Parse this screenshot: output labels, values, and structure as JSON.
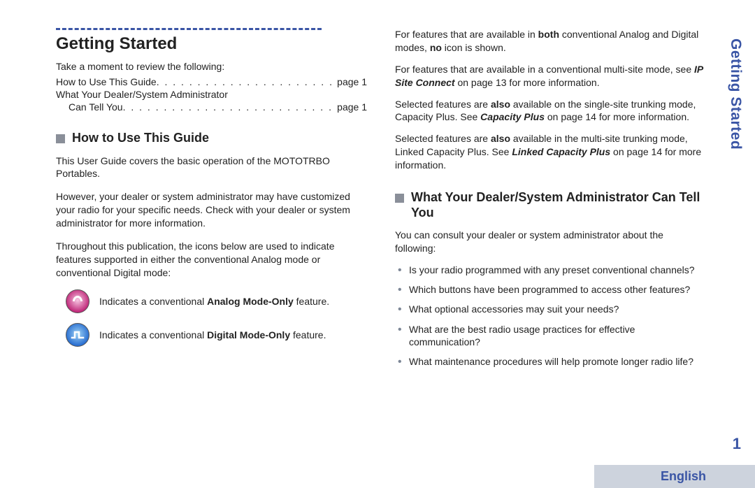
{
  "sideTab": "Getting Started",
  "pageNumber": "1",
  "langFooter": "English",
  "left": {
    "title": "Getting Started",
    "intro": "Take a moment to review the following:",
    "toc": {
      "row1Label": "How to Use This Guide",
      "row1Page": "page 1",
      "row2Label": "What Your Dealer/System Administrator",
      "row2SubLabel": "Can Tell You",
      "row2Page": "page 1"
    },
    "sub1": "How to Use This Guide",
    "p1": "This User Guide covers the basic operation of the MOTOTRBO Portables.",
    "p2": "However, your dealer or system administrator may have customized your radio for your specific needs. Check with your dealer or system administrator for more information.",
    "p3": "Throughout this publication, the icons below are used to indicate features supported in either the conventional Analog mode or conventional Digital mode:",
    "analogPrefix": "Indicates a conventional ",
    "analogBold": "Analog Mode-Only",
    "analogSuffix": " feature.",
    "digitalPrefix": "Indicates a conventional ",
    "digitalBold": "Digital Mode-Only",
    "digitalSuffix": " feature."
  },
  "right": {
    "p1a": "For features that are available in ",
    "p1b": "both",
    "p1c": " conventional Analog and Digital modes, ",
    "p1d": "no",
    "p1e": " icon is shown.",
    "p2a": "For features that are available in a conventional multi-site mode, see ",
    "p2b": "IP Site Connect",
    "p2c": " on page 13 for more information.",
    "p3a": "Selected features are ",
    "p3b": "also",
    "p3c": " available on the single-site trunking mode, Capacity Plus. See ",
    "p3d": "Capacity Plus",
    "p3e": " on page 14 for more information.",
    "p4a": "Selected features are ",
    "p4b": "also",
    "p4c": " available in the multi-site trunking mode, Linked Capacity Plus. See ",
    "p4d": "Linked Capacity Plus",
    "p4e": " on page 14 for more information.",
    "sub2": "What Your Dealer/System Administrator Can Tell You",
    "p5": "You can consult your dealer or system administrator about the following:",
    "q1": "Is your radio programmed with any preset conventional channels?",
    "q2": "Which buttons have been programmed to access other features?",
    "q3": "What optional accessories may suit your needs?",
    "q4": "What are the best radio usage practices for effective communication?",
    "q5": "What maintenance procedures will help promote longer radio life?"
  }
}
